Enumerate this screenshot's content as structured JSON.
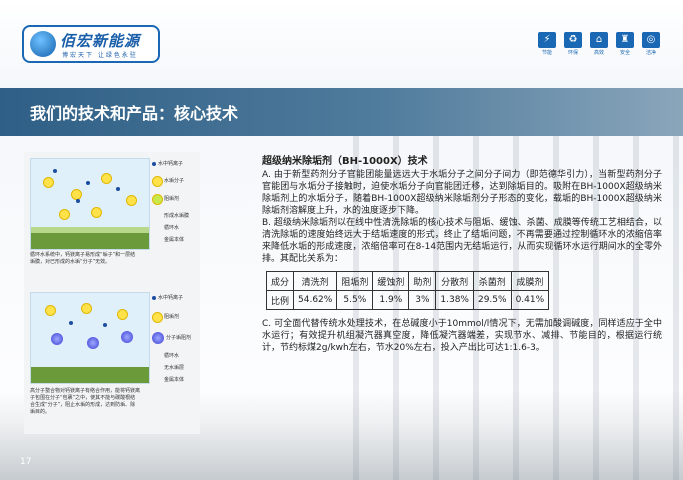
{
  "logo": {
    "name": "佰宏新能源",
    "slogan": "博宏天下  让绿色永驻"
  },
  "header_icons": [
    {
      "name": "节能",
      "symbol": "⚡"
    },
    {
      "name": "环保",
      "symbol": "♻"
    },
    {
      "name": "高效",
      "symbol": "⌂"
    },
    {
      "name": "安全",
      "symbol": "♜"
    },
    {
      "name": "洁净",
      "symbol": "◎"
    }
  ],
  "page_title": "我们的技术和产品：核心技术",
  "figure": {
    "legend_top": [
      "水中钙离子",
      "水垢分子",
      "阻垢剂",
      "形成水垢膜",
      "循环水",
      "金属本体"
    ],
    "caption_top": "循环水系统中，钙镁离子易形成“垢子”和一层结垢膜，对已形成的水垢“分子”无效。",
    "legend_bottom": [
      "水中钙离子",
      "阻垢剂",
      "分子垢阻剂",
      "循环水",
      "无水垢层",
      "金属本体"
    ],
    "caption_bottom": "高分子螯合物对钙镁离子有络合作用，能将钙镁离子包围在分子“包裹”之中，使其不能与碳酸根结合生成“分子”，阻止水垢的形成，达到防垢、除垢目的。"
  },
  "content": {
    "heading": "超级纳米除垢剂（BH-1000X）技术",
    "para_a": "A. 由于新型药剂分子官能团能量远远大于水垢分子之间分子间力（即范德华引力），当新型药剂分子官能团与水垢分子接触时，迫使水垢分子向官能团迁移，达到除垢目的。吸附在BH-1000X超级纳米除垢剂上的水垢分子，随着BH-1000X超级纳米除垢剂分子形态的变化，载垢的BH-1000X超级纳米除垢剂溶解度上升，水的浊度逐步下降。",
    "para_b": "B. 超级纳米除垢剂以在线中性清洗除垢的核心技术与阻垢、缓蚀、杀菌、成膜等传统工艺相结合，以清洗除垢的速度始终远大于结垢速度的形式，终止了结垢问题，不再需要通过控制循环水的浓缩倍率来降低水垢的形成速度，浓缩倍率可在8-14范围内无结垢运行，从而实现循环水运行期间水的全零外排。其配比关系为：",
    "table": {
      "header": [
        "成分",
        "清洗剂",
        "阻垢剂",
        "缓蚀剂",
        "助剂",
        "分散剂",
        "杀菌剂",
        "成膜剂"
      ],
      "row": [
        "比例",
        "54.62%",
        "5.5%",
        "1.9%",
        "3%",
        "1.38%",
        "29.5%",
        "0.41%"
      ]
    },
    "para_c": "C. 可全面代替传统水处理技术，在总碱度小于10mmol/l情况下，无需加酸调碱度，同样适应于全中水运行；有效提升机组凝汽器真空度，降低凝汽器端差，实现节水、减排、节能目的，根据运行统计，节约标煤2g/kwh左右，节水20%左右，投入产出比可达1:1.6-3。"
  },
  "page_number": "17"
}
